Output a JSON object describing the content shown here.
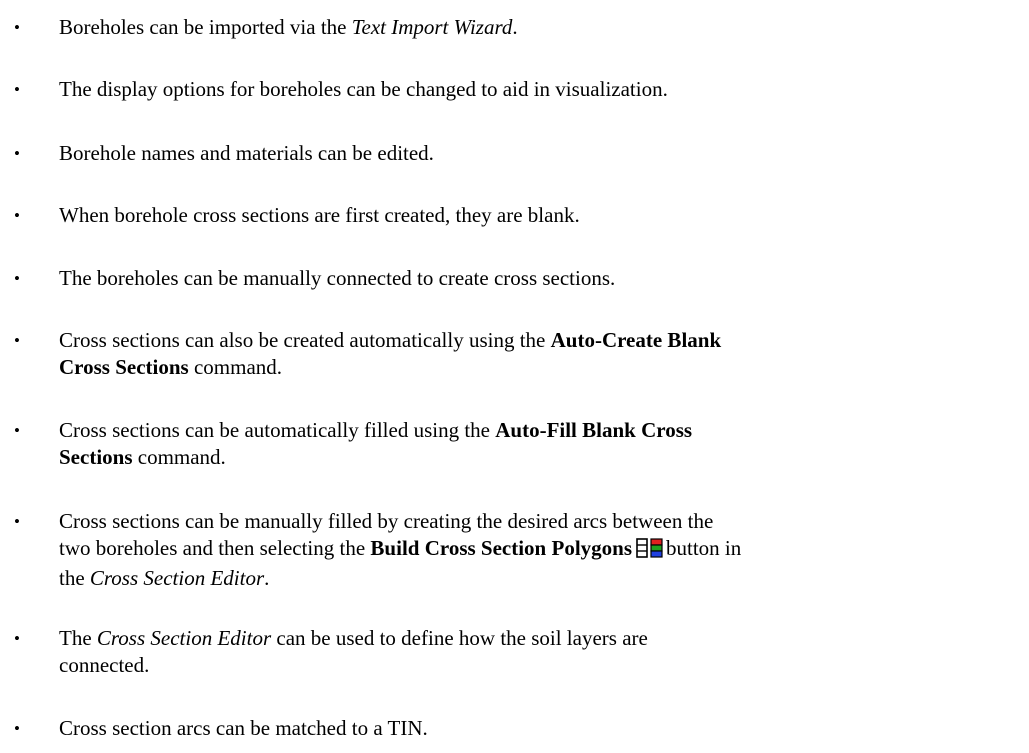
{
  "bullet_char": "•",
  "items": [
    {
      "parts": [
        {
          "t": "Boreholes can be imported via the "
        },
        {
          "t": "Text Import Wizard",
          "s": "i"
        },
        {
          "t": "."
        }
      ]
    },
    {
      "parts": [
        {
          "t": "The display options for boreholes can be changed to aid in visualization."
        }
      ]
    },
    {
      "parts": [
        {
          "t": "Borehole names and materials can be edited."
        }
      ]
    },
    {
      "parts": [
        {
          "t": "When borehole cross sections are first created, they are blank."
        }
      ]
    },
    {
      "parts": [
        {
          "t": "The boreholes can be manually connected to create cross sections."
        }
      ]
    },
    {
      "parts": [
        {
          "t": "Cross sections can also be created automatically using the "
        },
        {
          "t": "Auto-Create Blank",
          "s": "b"
        },
        {
          "br": true
        },
        {
          "t": "Cross Sections",
          "s": "b"
        },
        {
          "t": " command."
        }
      ]
    },
    {
      "parts": [
        {
          "t": "Cross sections can be automatically filled using the "
        },
        {
          "t": "Auto-Fill Blank Cross",
          "s": "b"
        },
        {
          "br": true
        },
        {
          "t": "Sections",
          "s": "b"
        },
        {
          "t": " command."
        }
      ]
    },
    {
      "parts": [
        {
          "t": "Cross sections can be manually filled by creating the desired arcs between the"
        },
        {
          "br": true
        },
        {
          "t": "two boreholes and then selecting the "
        },
        {
          "t": "Build Cross Section Polygons",
          "s": "b"
        },
        {
          "icon": "build-polygons-icon"
        },
        {
          "t": "button in"
        },
        {
          "br": true
        },
        {
          "t": "the "
        },
        {
          "t": "Cross Section Editor",
          "s": "i"
        },
        {
          "t": "."
        }
      ]
    },
    {
      "parts": [
        {
          "t": "The "
        },
        {
          "t": "Cross Section Editor",
          "s": "i"
        },
        {
          "t": " can be used to define how the soil layers are"
        },
        {
          "br": true
        },
        {
          "t": "connected."
        }
      ]
    },
    {
      "parts": [
        {
          "t": "Cross section arcs can be matched to a TIN."
        }
      ]
    }
  ]
}
